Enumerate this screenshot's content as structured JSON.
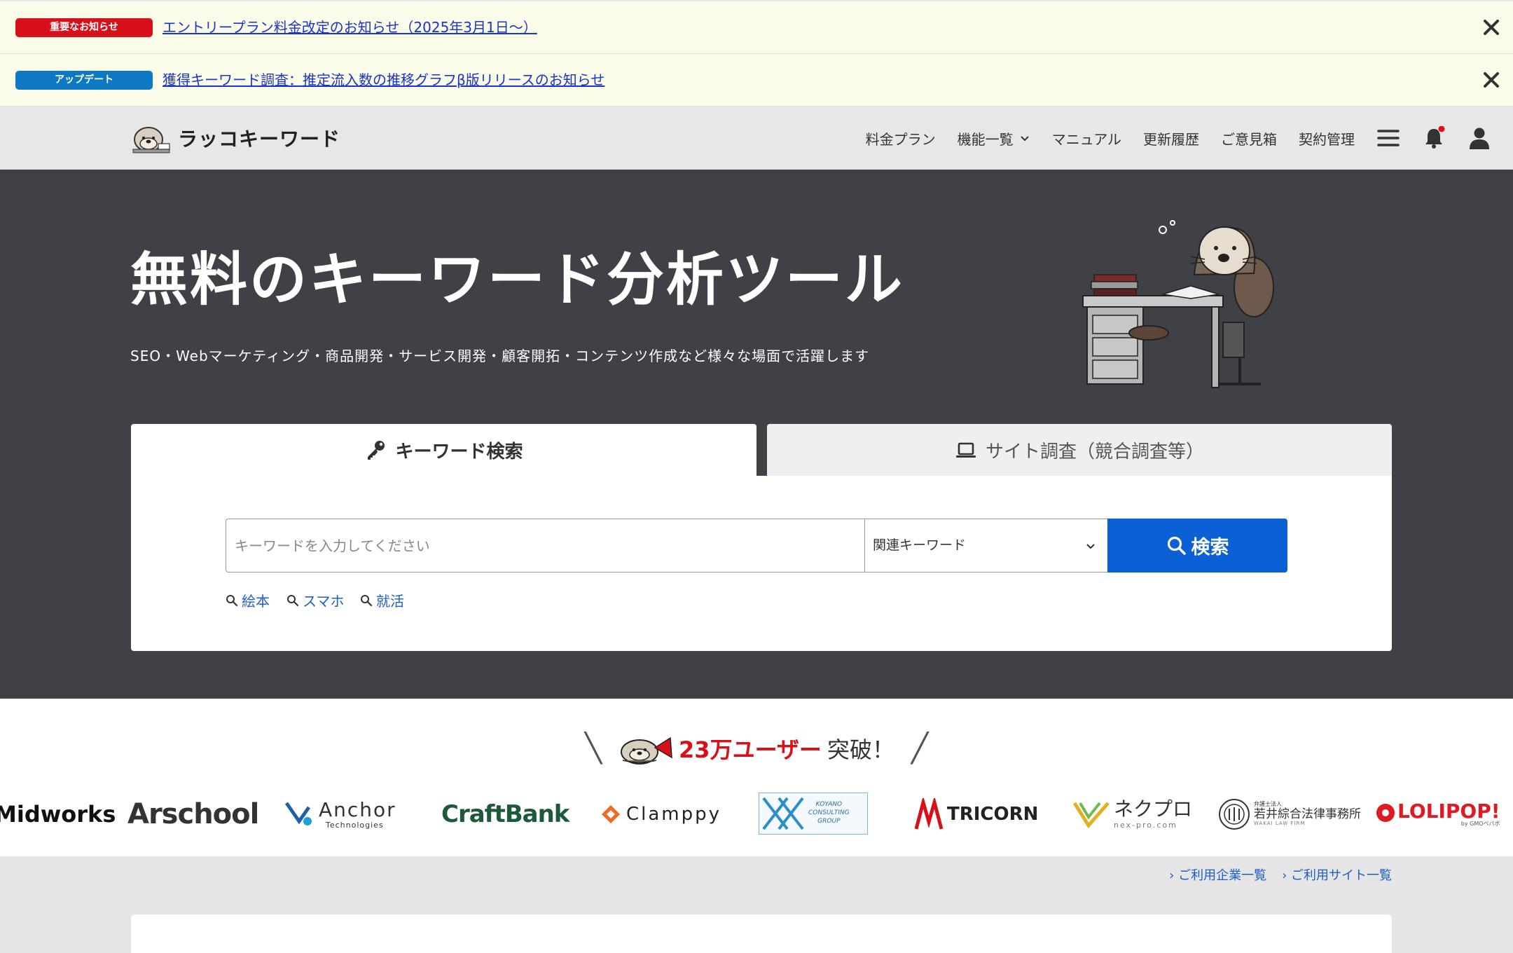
{
  "notices": [
    {
      "badge": "重要なお知らせ",
      "text": "エントリープラン料金改定のお知らせ（2025年3月1日〜）",
      "color": "#d8101a"
    },
    {
      "badge": "アップデート",
      "text": "獲得キーワード調査：推定流入数の推移グラフβ版リリースのお知らせ",
      "color": "#0d79c2"
    }
  ],
  "header": {
    "logo_text": "ラッコキーワード",
    "nav": [
      "料金プラン",
      "機能一覧",
      "マニュアル",
      "更新履歴",
      "ご意見箱",
      "契約管理"
    ],
    "icons": [
      "menu-icon",
      "bell-icon",
      "user-icon"
    ]
  },
  "hero": {
    "title": "無料のキーワード分析ツール",
    "subtitle": "SEO・Webマーケティング・商品開発・サービス開発・顧客開拓・コンテンツ作成など様々な場面で活躍します"
  },
  "search": {
    "tab_keyword": "キーワード検索",
    "tab_site": "サイト調査（競合調査等）",
    "placeholder": "キーワードを入力してください",
    "select_value": "関連キーワード",
    "button": "検索",
    "suggestions": [
      "絵本",
      "スマホ",
      "就活"
    ]
  },
  "users": {
    "count": "23万ユーザー",
    "suffix": "突破！",
    "logos": [
      "Midworks",
      "Arschool",
      "Anchor",
      "Technologies",
      "CraftBank",
      "Clamppy",
      "KOYANO",
      "CONSULTING",
      "GROUP",
      "TRICORN",
      "ネクプロ",
      "nex-pro.com",
      "弁護士法人",
      "若井綜合法律事務所",
      "WAKAI LAW FIRM",
      "LOLIPOP!",
      "by GMOペパボ"
    ]
  },
  "links": [
    "ご利用企業一覧",
    "ご利用サイト一覧"
  ],
  "colors": {
    "accent": "#0b60d6",
    "hero_bg": "#404147",
    "alert": "#d8101a"
  }
}
